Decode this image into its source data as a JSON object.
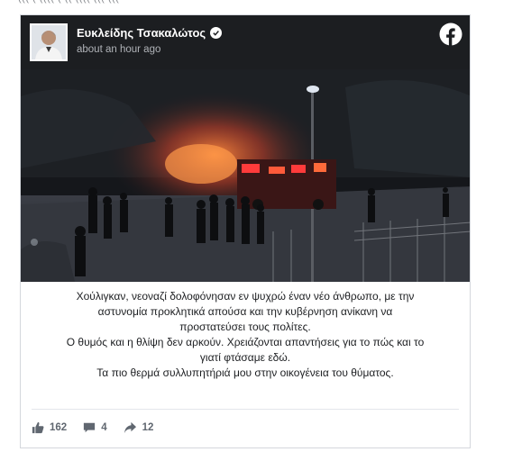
{
  "top_fragment": "((( ( ((((  ( (( ((((  (((  (((",
  "post": {
    "author": "Ευκλείδης Τσακαλώτος",
    "timestamp": "about an hour ago",
    "text_lines": [
      "Χούλιγκαν, νεοναζί δολοφόνησαν εν ψυχρώ έναν νέο άνθρωπο, με την",
      "αστυνομία προκλητικά απούσα και την κυβέρνηση ανίκανη να",
      "προστατεύσει τους πολίτες.",
      "Ο θυμός και η θλίψη δεν αρκούν. Χρειάζονται απαντήσεις για το πώς και το",
      "γιατί φτάσαμε εδώ.",
      "Τα πιο θερμά συλλυπητήριά μου στην οικογένεια του θύματος."
    ],
    "likes": "162",
    "comments": "4",
    "shares": "12"
  },
  "icons": {
    "header_logo": "facebook-logo-icon",
    "verified": "verified-check-icon",
    "like": "thumbs-up-icon",
    "comment": "comment-bubble-icon",
    "share": "share-arrow-icon"
  },
  "colors": {
    "header_bg": "#1c1e21",
    "text": "#1c1e21",
    "muted": "#606770",
    "fire": "#e8552a"
  }
}
